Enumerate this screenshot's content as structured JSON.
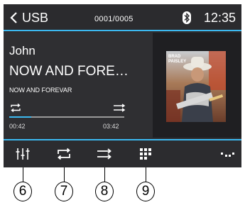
{
  "header": {
    "back_label": "USB",
    "track_counter": "0001/0005",
    "time": "12:35"
  },
  "now_playing": {
    "artist": "John",
    "title": "NOW AND FORE…",
    "album": "NOW AND FOREVAR",
    "elapsed": "00:42",
    "duration": "03:42",
    "progress_fraction": 0.19
  },
  "album_art": {
    "text_line1": "BRAD",
    "text_line2": "PAISLEY"
  },
  "callouts": [
    "6",
    "7",
    "8",
    "9"
  ],
  "colors": {
    "accent": "#3cb9f0",
    "background": "#2d2d30",
    "art_panel": "#1f1f22"
  },
  "icons": {
    "back": "chevron-left-icon",
    "bluetooth": "bluetooth-icon",
    "eq": "equalizer-icon",
    "repeat": "repeat-icon",
    "shuffle": "shuffle-icon",
    "grid": "grid-icon",
    "more": "more-icon"
  }
}
